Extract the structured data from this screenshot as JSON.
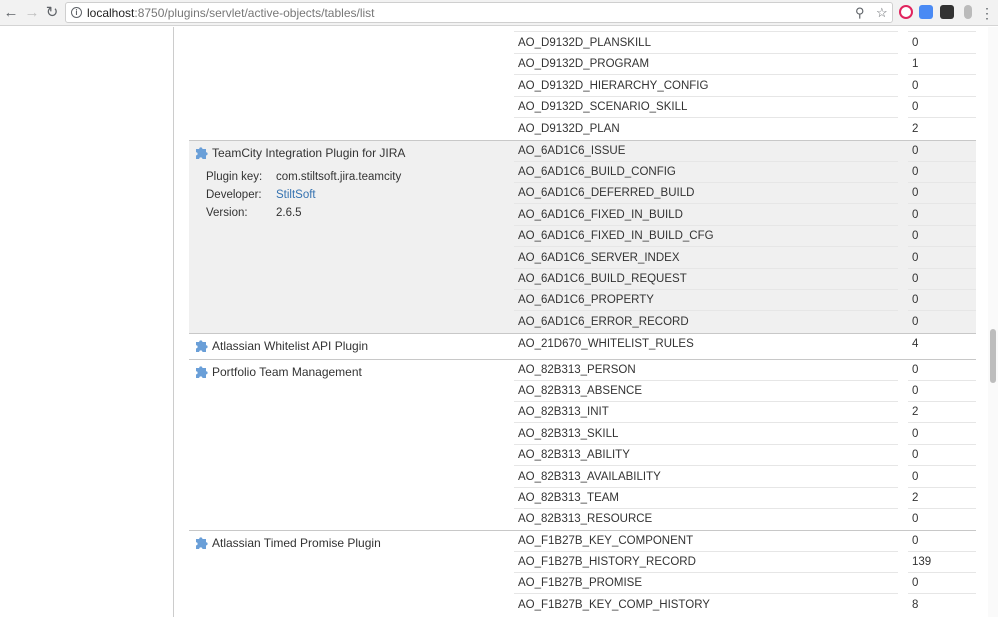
{
  "browser": {
    "url_host": "localhost",
    "url_path": ":8750/plugins/servlet/active-objects/tables/list"
  },
  "colors": {
    "link": "#3572b0",
    "shaded_bg": "#f0f0f0",
    "puzzle_icon": "#6a9fd8"
  },
  "top_partial": {
    "rows": [
      {
        "name": "AO_D9132D_PLANSKILL",
        "count": "0"
      },
      {
        "name": "AO_D9132D_PROGRAM",
        "count": "1"
      },
      {
        "name": "AO_D9132D_HIERARCHY_CONFIG",
        "count": "0"
      },
      {
        "name": "AO_D9132D_SCENARIO_SKILL",
        "count": "0"
      },
      {
        "name": "AO_D9132D_PLAN",
        "count": "2"
      }
    ]
  },
  "plugins": [
    {
      "name": "TeamCity Integration Plugin for JIRA",
      "meta": {
        "key_label": "Plugin key:",
        "key_value": "com.stiltsoft.jira.teamcity",
        "dev_label": "Developer:",
        "dev_value": "StiltSoft",
        "ver_label": "Version:",
        "ver_value": "2.6.5"
      },
      "rows": [
        {
          "name": "AO_6AD1C6_ISSUE",
          "count": "0"
        },
        {
          "name": "AO_6AD1C6_BUILD_CONFIG",
          "count": "0"
        },
        {
          "name": "AO_6AD1C6_DEFERRED_BUILD",
          "count": "0"
        },
        {
          "name": "AO_6AD1C6_FIXED_IN_BUILD",
          "count": "0"
        },
        {
          "name": "AO_6AD1C6_FIXED_IN_BUILD_CFG",
          "count": "0"
        },
        {
          "name": "AO_6AD1C6_SERVER_INDEX",
          "count": "0"
        },
        {
          "name": "AO_6AD1C6_BUILD_REQUEST",
          "count": "0"
        },
        {
          "name": "AO_6AD1C6_PROPERTY",
          "count": "0"
        },
        {
          "name": "AO_6AD1C6_ERROR_RECORD",
          "count": "0"
        }
      ]
    },
    {
      "name": "Atlassian Whitelist API Plugin",
      "rows": [
        {
          "name": "AO_21D670_WHITELIST_RULES",
          "count": "4"
        }
      ]
    },
    {
      "name": "Portfolio Team Management",
      "rows": [
        {
          "name": "AO_82B313_PERSON",
          "count": "0"
        },
        {
          "name": "AO_82B313_ABSENCE",
          "count": "0"
        },
        {
          "name": "AO_82B313_INIT",
          "count": "2"
        },
        {
          "name": "AO_82B313_SKILL",
          "count": "0"
        },
        {
          "name": "AO_82B313_ABILITY",
          "count": "0"
        },
        {
          "name": "AO_82B313_AVAILABILITY",
          "count": "0"
        },
        {
          "name": "AO_82B313_TEAM",
          "count": "2"
        },
        {
          "name": "AO_82B313_RESOURCE",
          "count": "0"
        }
      ]
    },
    {
      "name": "Atlassian Timed Promise Plugin",
      "rows": [
        {
          "name": "AO_F1B27B_KEY_COMPONENT",
          "count": "0"
        },
        {
          "name": "AO_F1B27B_HISTORY_RECORD",
          "count": "139"
        },
        {
          "name": "AO_F1B27B_PROMISE",
          "count": "0"
        },
        {
          "name": "AO_F1B27B_KEY_COMP_HISTORY",
          "count": "8"
        }
      ]
    }
  ]
}
